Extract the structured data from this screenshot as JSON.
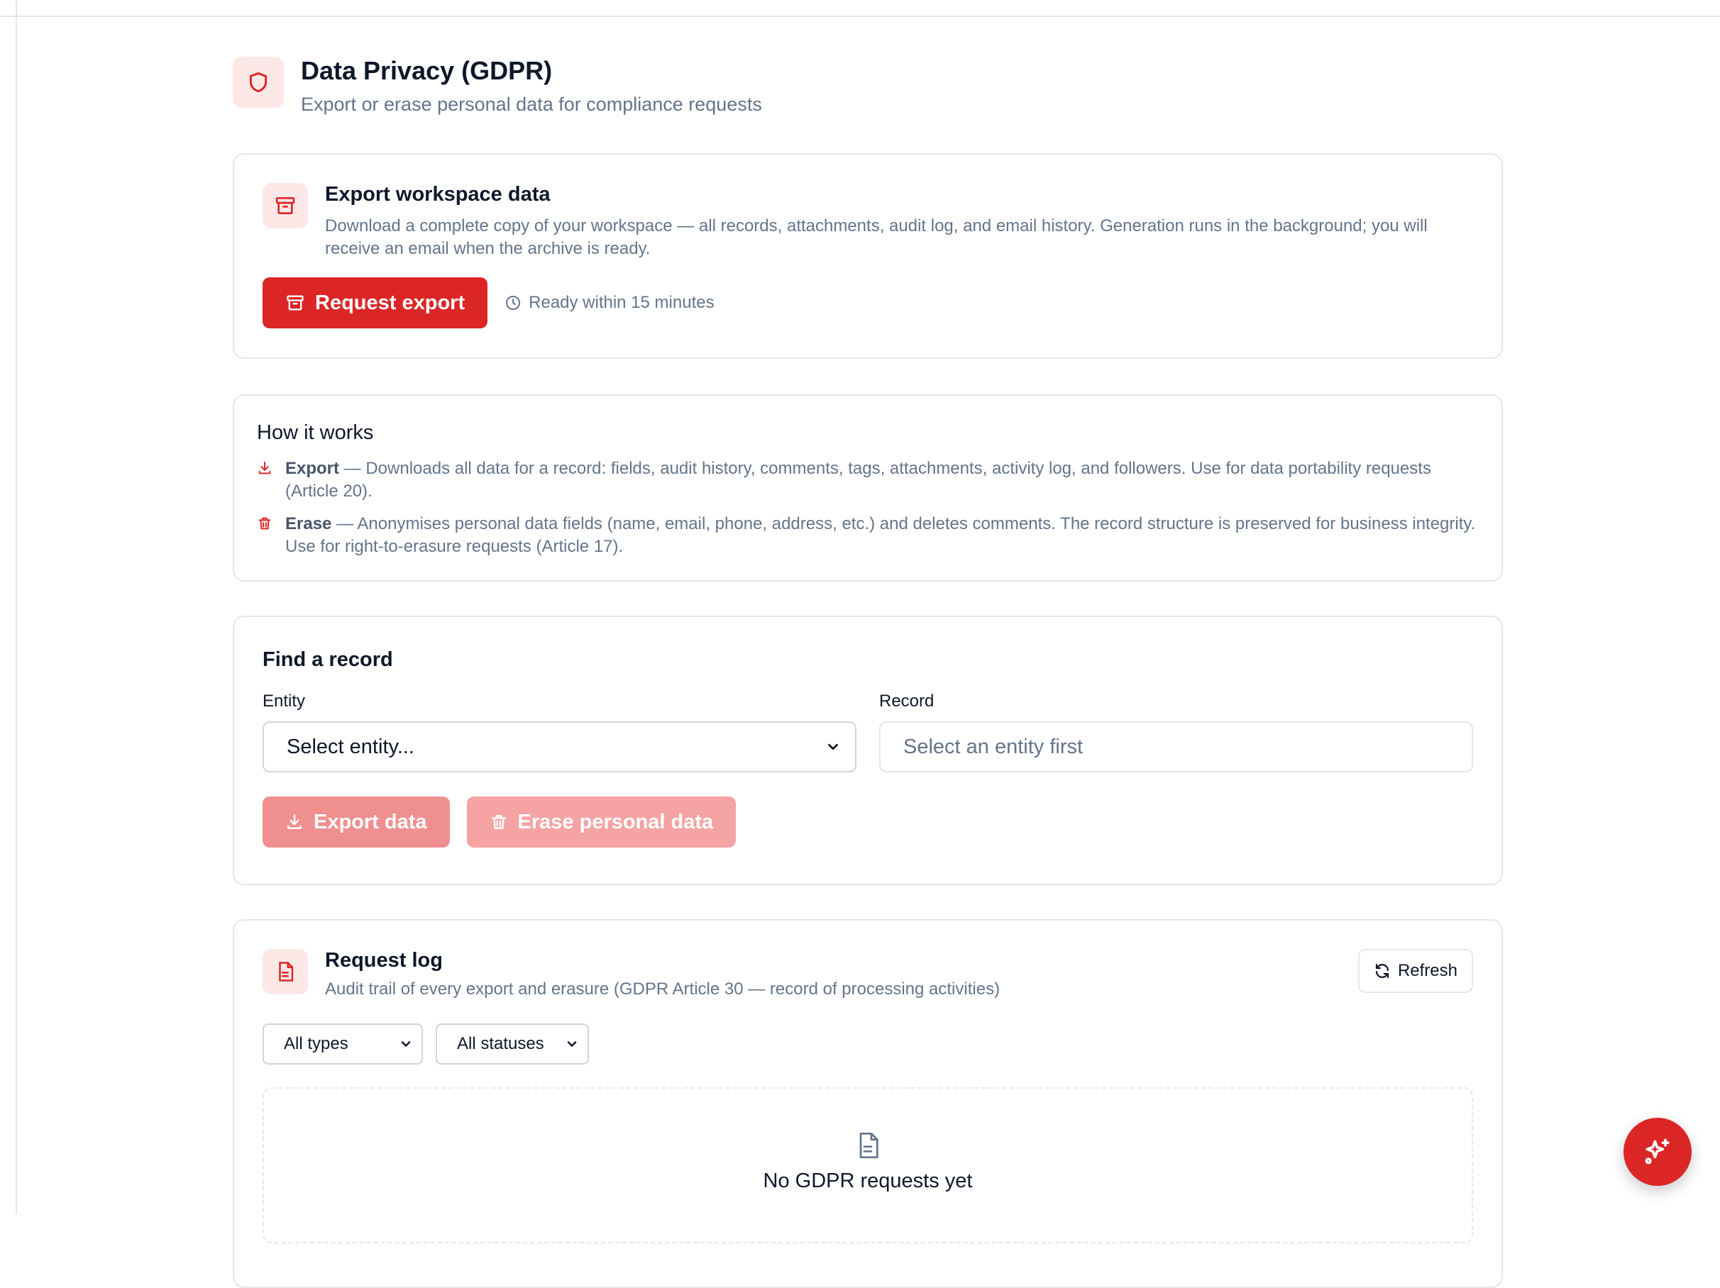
{
  "header": {
    "title": "Data Privacy (GDPR)",
    "subtitle": "Export or erase personal data for compliance requests",
    "icon": "shield-icon"
  },
  "export_card": {
    "icon": "archive-icon",
    "title": "Export workspace data",
    "description": "Download a complete copy of your workspace — all records, attachments, audit log, and email history. Generation runs in the background; you will receive an email when the archive is ready.",
    "button_label": "Request export",
    "eta": "Ready within 15 minutes"
  },
  "how_it_works": {
    "title": "How it works",
    "items": [
      {
        "icon": "download-icon",
        "term": "Export",
        "text": " — Downloads all data for a record: fields, audit history, comments, tags, attachments, activity log, and followers. Use for data portability requests (Article 20)."
      },
      {
        "icon": "trash-icon",
        "term": "Erase",
        "text": " — Anonymises personal data fields (name, email, phone, address, etc.) and deletes comments. The record structure is preserved for business integrity. Use for right-to-erasure requests (Article 17)."
      }
    ]
  },
  "find_record": {
    "title": "Find a record",
    "entity_label": "Entity",
    "entity_value": "Select entity...",
    "record_label": "Record",
    "record_placeholder": "Select an entity first",
    "export_button": "Export data",
    "erase_button": "Erase personal data"
  },
  "request_log": {
    "icon": "file-text-icon",
    "title": "Request log",
    "description": "Audit trail of every export and erasure (GDPR Article 30 — record of processing activities)",
    "refresh_label": "Refresh",
    "type_filter": "All types",
    "status_filter": "All statuses",
    "empty_title": "No GDPR requests yet"
  },
  "colors": {
    "accent": "#dc2626",
    "accent_soft": "#fde8e8",
    "muted_text": "#64748b",
    "border": "#e5e7eb"
  }
}
